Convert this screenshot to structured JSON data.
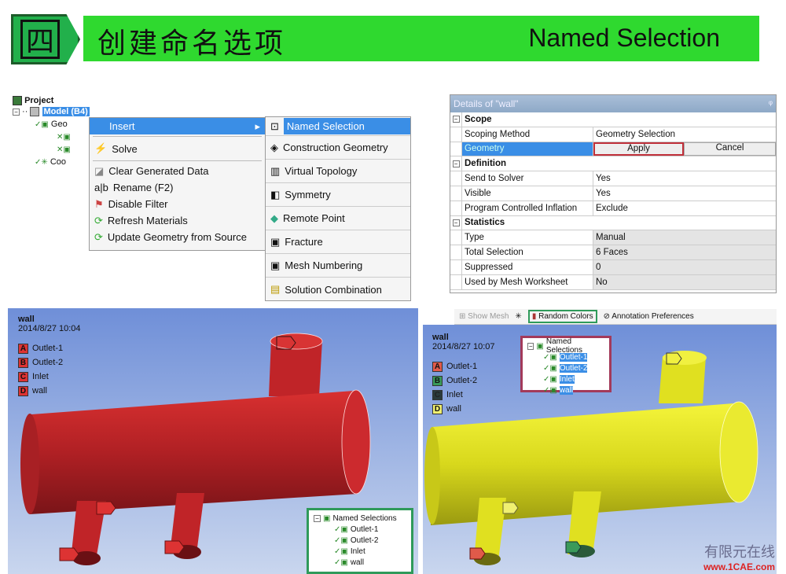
{
  "header": {
    "badge": "四",
    "title_cn": "创建命名选项",
    "title_en": "Named Selection"
  },
  "tree": {
    "project": "Project",
    "model": "Model (B4)",
    "geometry": "Geo",
    "coordinate": "Coo"
  },
  "context_menu": {
    "items": [
      {
        "label": "Insert",
        "icon": "none",
        "highlighted": true,
        "submenu": true
      },
      {
        "label": "Solve",
        "icon": "lightning-icon"
      },
      {
        "label": "Clear Generated Data",
        "icon": "eraser-icon"
      },
      {
        "label": "Rename (F2)",
        "icon": "rename-icon"
      },
      {
        "label": "Disable Filter",
        "icon": "filter-icon"
      },
      {
        "label": "Refresh Materials",
        "icon": "refresh-icon"
      },
      {
        "label": "Update Geometry from Source",
        "icon": "refresh-icon"
      }
    ]
  },
  "submenu": {
    "items": [
      {
        "label": "Named Selection",
        "highlighted": true
      },
      {
        "label": "Construction Geometry"
      },
      {
        "label": "Virtual Topology"
      },
      {
        "label": "Symmetry"
      },
      {
        "label": "Remote Point"
      },
      {
        "label": "Fracture"
      },
      {
        "label": "Mesh Numbering"
      },
      {
        "label": "Solution Combination"
      }
    ]
  },
  "details": {
    "title": "Details of \"wall\"",
    "groups": [
      {
        "name": "Scope",
        "rows": [
          {
            "k": "Scoping Method",
            "v": "Geometry Selection"
          }
        ]
      },
      {
        "name": "Definition",
        "rows": [
          {
            "k": "Send to Solver",
            "v": "Yes"
          },
          {
            "k": "Visible",
            "v": "Yes"
          },
          {
            "k": "Program Controlled Inflation",
            "v": "Exclude"
          }
        ]
      },
      {
        "name": "Statistics",
        "rows": [
          {
            "k": "Type",
            "v": "Manual"
          },
          {
            "k": "Total Selection",
            "v": "6 Faces"
          },
          {
            "k": "Suppressed",
            "v": "0"
          },
          {
            "k": "Used by Mesh Worksheet",
            "v": "No"
          }
        ]
      }
    ],
    "geometry_label": "Geometry",
    "apply": "Apply",
    "cancel": "Cancel"
  },
  "left_view": {
    "title": "wall",
    "timestamp": "2014/8/27 10:04",
    "legend": [
      {
        "tag": "A",
        "label": "Outlet-1"
      },
      {
        "tag": "B",
        "label": "Outlet-2"
      },
      {
        "tag": "C",
        "label": "Inlet"
      },
      {
        "tag": "D",
        "label": "wall"
      }
    ],
    "color": "#c0262a",
    "named_selections": {
      "root": "Named Selections",
      "items": [
        "Outlet-1",
        "Outlet-2",
        "Inlet",
        "wall"
      ]
    }
  },
  "right_view": {
    "toolbar": {
      "show_mesh": "Show Mesh",
      "random_colors": "Random Colors",
      "annotation": "Annotation Preferences"
    },
    "title": "wall",
    "timestamp": "2014/8/27 10:07",
    "legend": [
      {
        "tag": "A",
        "label": "Outlet-1",
        "color": "#e05a4a"
      },
      {
        "tag": "B",
        "label": "Outlet-2",
        "color": "#3a9a5a"
      },
      {
        "tag": "C",
        "label": "Inlet",
        "color": "#2a3a3a"
      },
      {
        "tag": "D",
        "label": "wall",
        "color": "#f0f070"
      }
    ],
    "color": "#e0e020",
    "named_selections": {
      "root": "Named Selections",
      "items": [
        "Outlet-1",
        "Outlet-2",
        "Inlet",
        "wall"
      ]
    }
  },
  "watermark": {
    "text": "有限元在线",
    "url": "www.1CAE.com"
  }
}
